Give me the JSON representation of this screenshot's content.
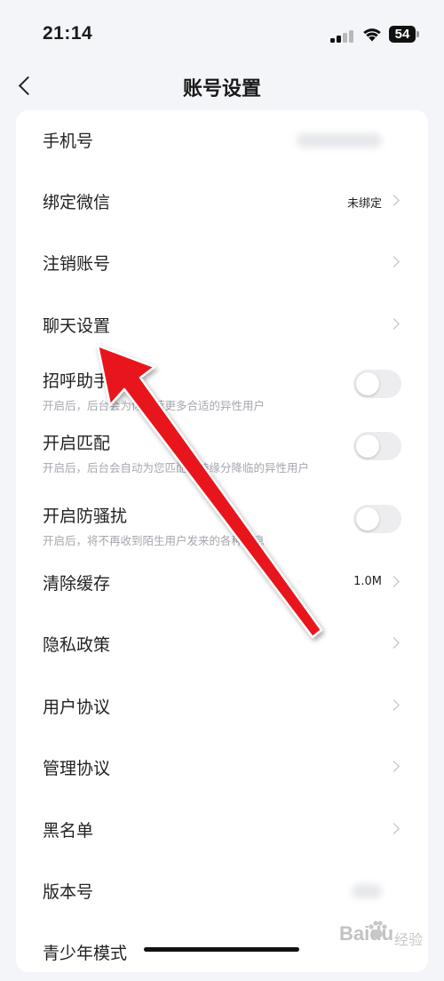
{
  "status_bar": {
    "time": "21:14",
    "battery": "54"
  },
  "header": {
    "title": "账号设置"
  },
  "rows": [
    {
      "label": "手机号"
    },
    {
      "label": "绑定微信",
      "value": "未绑定"
    },
    {
      "label": "注销账号"
    },
    {
      "label": "聊天设置"
    }
  ],
  "toggles": [
    {
      "label": "招呼助手",
      "desc": "开启后，后台会为你推荐更多合适的异性用户",
      "on": false
    },
    {
      "label": "开启匹配",
      "desc": "开启后，后台会自动为您匹配等待缘分降临的异性用户",
      "on": false
    },
    {
      "label": "开启防骚扰",
      "desc": "开启后，将不再收到陌生用户发来的各种消息",
      "on": false
    }
  ],
  "rows2": [
    {
      "label": "清除缓存",
      "value": "1.0M"
    },
    {
      "label": "隐私政策"
    },
    {
      "label": "用户协议"
    },
    {
      "label": "管理协议"
    },
    {
      "label": "黑名单"
    },
    {
      "label": "版本号"
    },
    {
      "label": "青少年模式"
    }
  ],
  "watermark": {
    "text": "Baidu",
    "sub": "经验"
  },
  "colors": {
    "arrow": "#e8151b",
    "background": "#f4f5f9",
    "card": "#ffffff"
  }
}
